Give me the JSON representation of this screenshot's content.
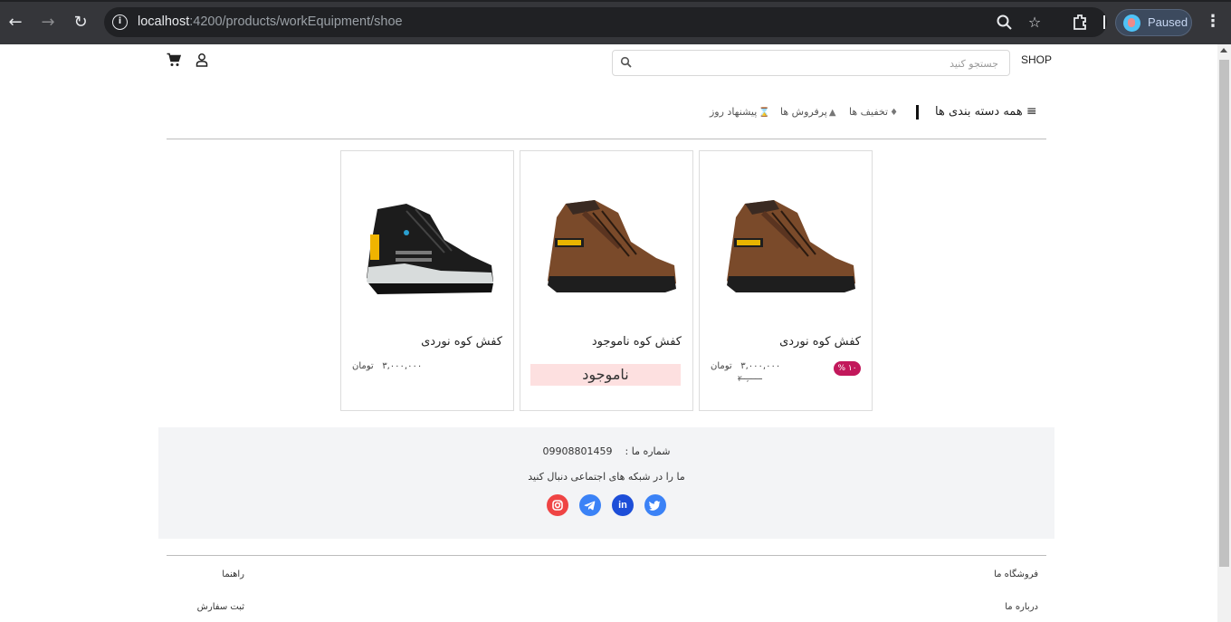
{
  "browser": {
    "url_host": "localhost",
    "url_rest": ":4200/products/workEquipment/shoe",
    "profile_status": "Paused"
  },
  "header": {
    "logo": "SHOP",
    "search_placeholder": "جستجو کنید"
  },
  "menu": {
    "all_categories": "همه دسته بندی ها",
    "items": [
      "تخفیف ها",
      "پرفروش ها",
      "پیشنهاد روز"
    ]
  },
  "products": [
    {
      "title": "کفش کوه نوردی",
      "price": "۳,۰۰۰,۰۰۰",
      "currency": "تومان",
      "old_price": "۲۰,۰۰۰",
      "discount": "۱۰ %",
      "color": "brown"
    },
    {
      "title": "کفش کوه ناموجود",
      "status": "ناموجود",
      "color": "brown"
    },
    {
      "title": "کفش کوه نوردی",
      "price": "۳,۰۰۰,۰۰۰",
      "currency": "تومان",
      "color": "black"
    }
  ],
  "contact": {
    "phone_label": "شماره ما :",
    "phone": "09908801459",
    "follow_text": "ما را در شبکه های اجتماعی دنبال کنید",
    "social": [
      {
        "name": "twitter",
        "color": "#3b82f6"
      },
      {
        "name": "linkedin",
        "color": "#1d4ed8"
      },
      {
        "name": "telegram",
        "color": "#3b82f6"
      },
      {
        "name": "instagram",
        "color": "#ef4444"
      }
    ]
  },
  "footer": {
    "store_heading": "فروشگاه ما",
    "about": "درباره ما",
    "guide_heading": "راهنما",
    "order": "ثبت سفارش"
  }
}
